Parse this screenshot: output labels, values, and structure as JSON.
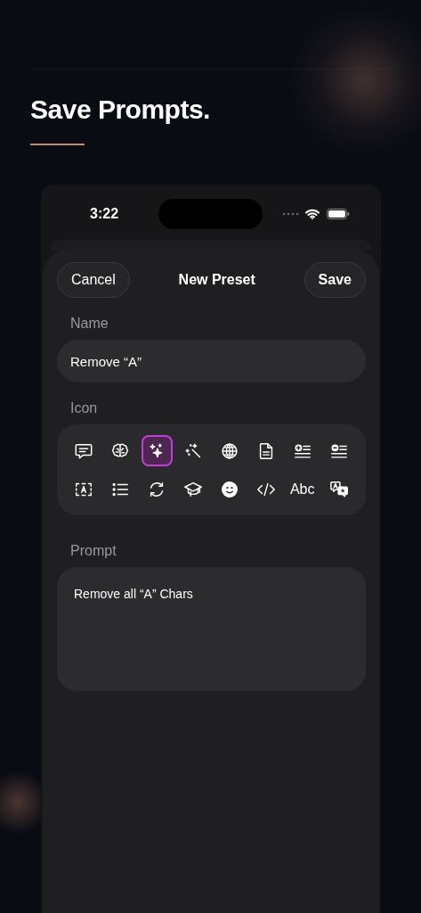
{
  "header": {
    "title": "Save Prompts."
  },
  "status_bar": {
    "time": "3:22"
  },
  "sheet": {
    "cancel": "Cancel",
    "title": "New Preset",
    "save": "Save"
  },
  "name": {
    "label": "Name",
    "value": "Remove “A”"
  },
  "icon_picker": {
    "label": "Icon",
    "options": [
      {
        "kind": "symbol",
        "selected": false
      },
      {
        "kind": "symbol",
        "selected": false
      },
      {
        "kind": "symbol",
        "selected": true
      },
      {
        "kind": "symbol",
        "selected": false
      },
      {
        "kind": "symbol",
        "selected": false
      },
      {
        "kind": "symbol",
        "selected": false
      },
      {
        "kind": "symbol",
        "selected": false
      },
      {
        "kind": "symbol",
        "selected": false
      },
      {
        "kind": "symbol",
        "selected": false
      },
      {
        "kind": "symbol",
        "selected": false
      },
      {
        "kind": "symbol",
        "selected": false
      },
      {
        "kind": "symbol",
        "selected": false
      },
      {
        "kind": "symbol",
        "selected": false
      },
      {
        "kind": "symbol",
        "selected": false
      },
      {
        "kind": "text",
        "label": "Abc",
        "selected": false
      },
      {
        "kind": "symbol",
        "selected": false
      }
    ]
  },
  "prompt": {
    "label": "Prompt",
    "value": "Remove all “A” Chars"
  }
}
